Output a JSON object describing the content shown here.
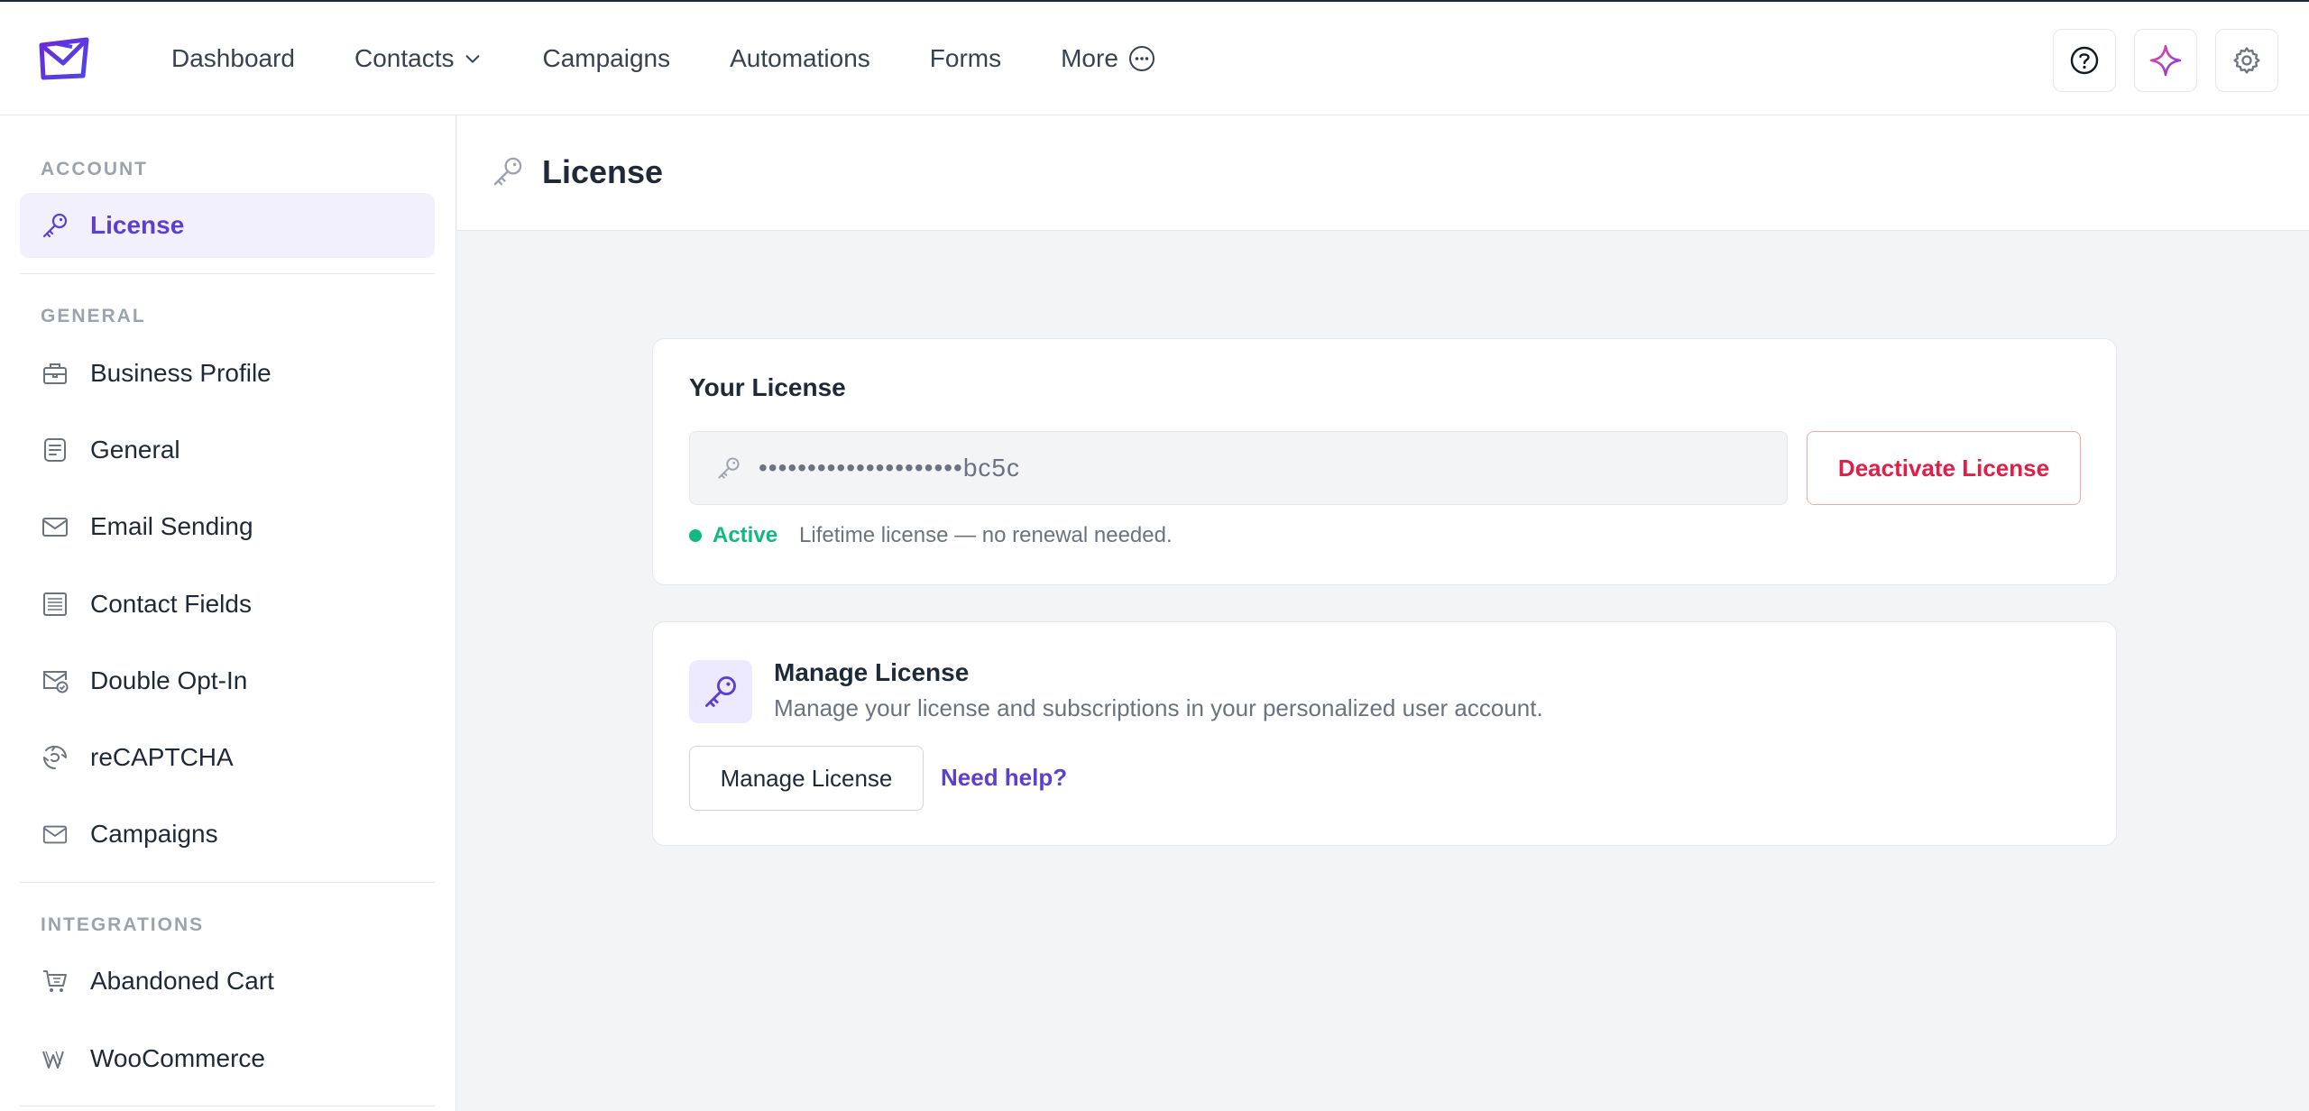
{
  "nav": {
    "items": [
      {
        "label": "Dashboard"
      },
      {
        "label": "Contacts"
      },
      {
        "label": "Campaigns"
      },
      {
        "label": "Automations"
      },
      {
        "label": "Forms"
      },
      {
        "label": "More"
      }
    ]
  },
  "sidebar": {
    "sections": {
      "account": "ACCOUNT",
      "general": "GENERAL",
      "integrations": "INTEGRATIONS"
    },
    "items": {
      "license": "License",
      "business_profile": "Business Profile",
      "general": "General",
      "email_sending": "Email Sending",
      "contact_fields": "Contact Fields",
      "double_opt_in": "Double Opt-In",
      "recaptcha": "reCAPTCHA",
      "campaigns": "Campaigns",
      "abandoned_cart": "Abandoned Cart",
      "woocommerce": "WooCommerce"
    }
  },
  "header": {
    "title": "License"
  },
  "license_card": {
    "title": "Your License",
    "masked_key": "•••••••••••••••••••••bc5c",
    "deactivate_label": "Deactivate License",
    "status": "Active",
    "note": "Lifetime license — no renewal needed."
  },
  "manage_card": {
    "title": "Manage License",
    "description": "Manage your license and subscriptions in your personalized user account.",
    "button_label": "Manage License",
    "help_label": "Need help?"
  },
  "colors": {
    "accent": "#5b3fd0",
    "danger": "#e11d48",
    "success": "#10b981"
  }
}
